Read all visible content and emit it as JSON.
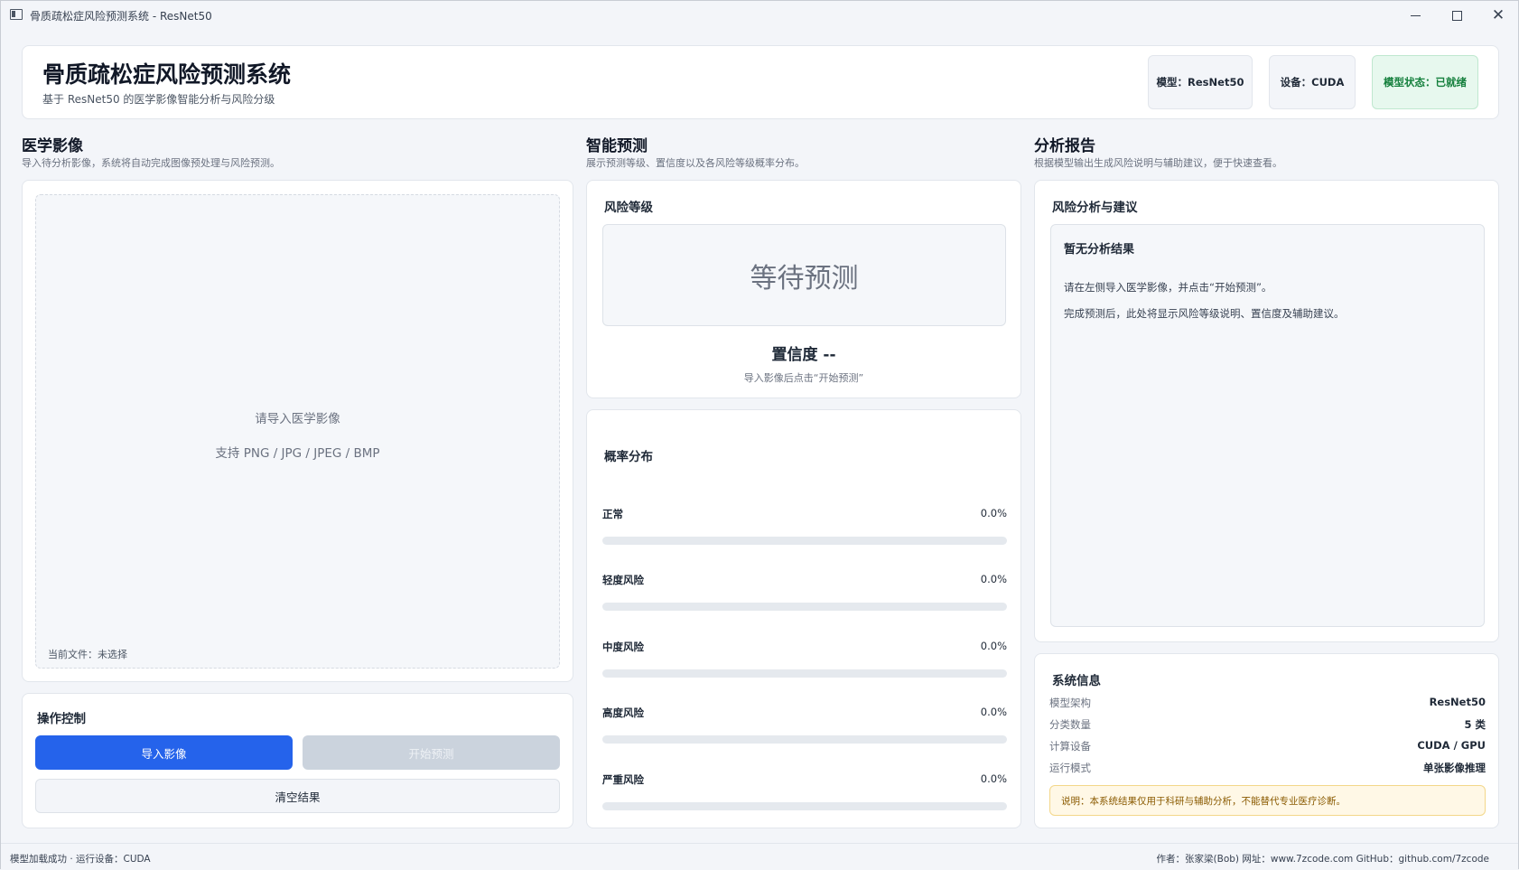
{
  "window": {
    "title": "骨质疏松症风险预测系统 - ResNet50"
  },
  "header": {
    "title": "骨质疏松症风险预测系统",
    "subtitle": "基于 ResNet50 的医学影像智能分析与风险分级",
    "model_pill": "模型：ResNet50",
    "device_pill": "设备：CUDA",
    "status_pill": "模型状态：已就绪"
  },
  "sections": {
    "image": {
      "title": "医学影像",
      "desc": "导入待分析影像，系统将自动完成图像预处理与风险预测。"
    },
    "predict": {
      "title": "智能预测",
      "desc": "展示预测等级、置信度以及各风险等级概率分布。"
    },
    "report": {
      "title": "分析报告",
      "desc": "根据模型输出生成风险说明与辅助建议，便于快速查看。"
    }
  },
  "image_panel": {
    "placeholder_line1": "请导入医学影像",
    "placeholder_line2": "支持 PNG / JPG / JPEG / BMP",
    "current_file": "当前文件：未选择"
  },
  "controls": {
    "title": "操作控制",
    "import_label": "导入影像",
    "predict_label": "开始预测",
    "clear_label": "清空结果"
  },
  "risk": {
    "title": "风险等级",
    "level_text": "等待预测",
    "confidence_text": "置信度  --",
    "hint": "导入影像后点击“开始预测”"
  },
  "probability": {
    "title": "概率分布",
    "rows": [
      {
        "label": "正常",
        "value": "0.0%",
        "fraction": 0.0
      },
      {
        "label": "轻度风险",
        "value": "0.0%",
        "fraction": 0.0
      },
      {
        "label": "中度风险",
        "value": "0.0%",
        "fraction": 0.0
      },
      {
        "label": "高度风险",
        "value": "0.0%",
        "fraction": 0.0
      },
      {
        "label": "严重风险",
        "value": "0.0%",
        "fraction": 0.0
      }
    ]
  },
  "report": {
    "title": "风险分析与建议",
    "heading": "暂无分析结果",
    "line1": "请在左侧导入医学影像，并点击“开始预测”。",
    "line2": "完成预测后，此处将显示风险等级说明、置信度及辅助建议。"
  },
  "system": {
    "title": "系统信息",
    "rows": [
      {
        "key": "模型架构",
        "value": "ResNet50"
      },
      {
        "key": "分类数量",
        "value": "5 类"
      },
      {
        "key": "计算设备",
        "value": "CUDA / GPU"
      },
      {
        "key": "运行模式",
        "value": "单张影像推理"
      }
    ],
    "disclaimer": "说明：本系统结果仅用于科研与辅助分析，不能替代专业医疗诊断。"
  },
  "statusbar": {
    "left": "模型加载成功 · 运行设备：CUDA",
    "right": "作者：张家梁(Bob)  网址：www.7zcode.com GitHub：github.com/7zcode"
  },
  "colors": {
    "primary": "#2563eb",
    "disabled": "#cbd3dd",
    "ready_bg": "#e7f8ee",
    "ready_text": "#15803d",
    "warning_bg": "#fff8e6"
  }
}
